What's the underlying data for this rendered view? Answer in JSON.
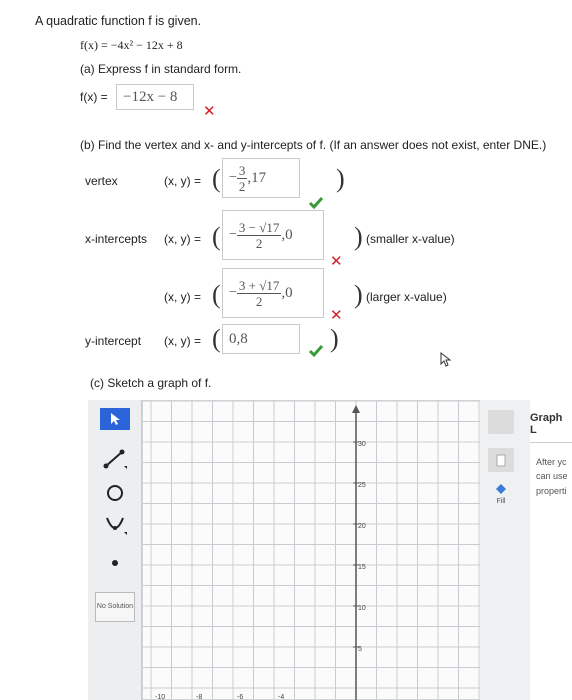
{
  "question": {
    "title": "A quadratic function f is given.",
    "function_text": "f(x) = −4x² − 12x + 8",
    "part_a": "(a) Express f in standard form.",
    "part_a_lhs": "f(x) =",
    "part_a_answer": "−12x − 8",
    "part_b": "(b) Find the vertex and x- and y-intercepts of f. (If an answer does not exist, enter DNE.)",
    "part_c": "(c) Sketch a graph of f."
  },
  "rows": {
    "vertex_label": "vertex",
    "xint_label": "x-intercepts",
    "yint_label": "y-intercept",
    "xy": "(x, y) =",
    "smaller": "(smaller x-value)",
    "larger": "(larger x-value)"
  },
  "answers": {
    "vertex_num": "3",
    "vertex_den": "2",
    "vertex_y": ",17",
    "xint1_num": "3 − √17",
    "xint1_den": "2",
    "xint1_y": ",0",
    "xint2_num": "3 + √17",
    "xint2_den": "2",
    "xint2_y": ",0",
    "yint": "0,8"
  },
  "status": {
    "part_a": "wrong",
    "vertex": "correct",
    "xint1": "wrong",
    "xint2": "wrong",
    "yint": "correct"
  },
  "tools": {
    "no_solution": "No Solution"
  },
  "graph": {
    "y_ticks": [
      "30",
      "25",
      "20",
      "15",
      "10",
      "5"
    ],
    "x_ticks": [
      "-10",
      "-8",
      "-6",
      "-4"
    ]
  },
  "right_panel": {
    "fill_label": "Fill",
    "graph_tab": "Graph L",
    "after_text_1": "After yc",
    "after_text_2": "can use",
    "after_text_3": "properti"
  },
  "colors": {
    "wrong": "#d0202a",
    "correct": "#3a9a3a",
    "tool_active": "#2a64d8"
  }
}
